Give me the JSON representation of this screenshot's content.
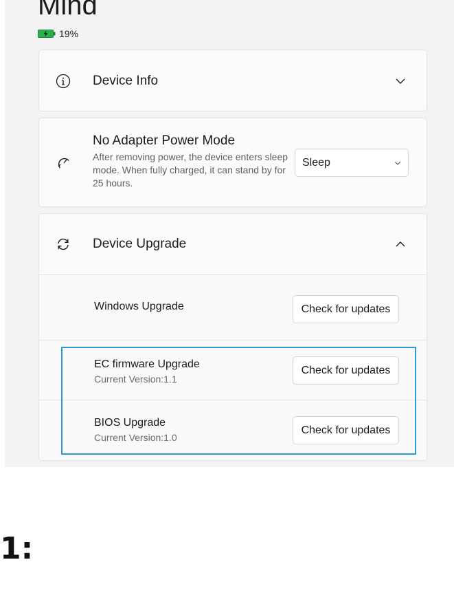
{
  "app": {
    "title": "Mind",
    "battery_percent": "19%"
  },
  "device_info": {
    "label": "Device Info"
  },
  "power_mode": {
    "title": "No Adapter Power Mode",
    "description": "After removing power, the device enters sleep mode. When fully charged, it can stand by for 25 hours.",
    "selected": "Sleep"
  },
  "device_upgrade": {
    "label": "Device Upgrade",
    "items": [
      {
        "title": "Windows Upgrade",
        "version": "",
        "button": "Check for updates"
      },
      {
        "title": "EC firmware Upgrade",
        "version": "Current Version:1.1",
        "button": "Check for updates"
      },
      {
        "title": "BIOS Upgrade",
        "version": "Current Version:1.0",
        "button": "Check for updates"
      }
    ]
  },
  "step_label": "1:",
  "colors": {
    "highlight": "#2a9bd2",
    "battery": "#2bb24c"
  }
}
